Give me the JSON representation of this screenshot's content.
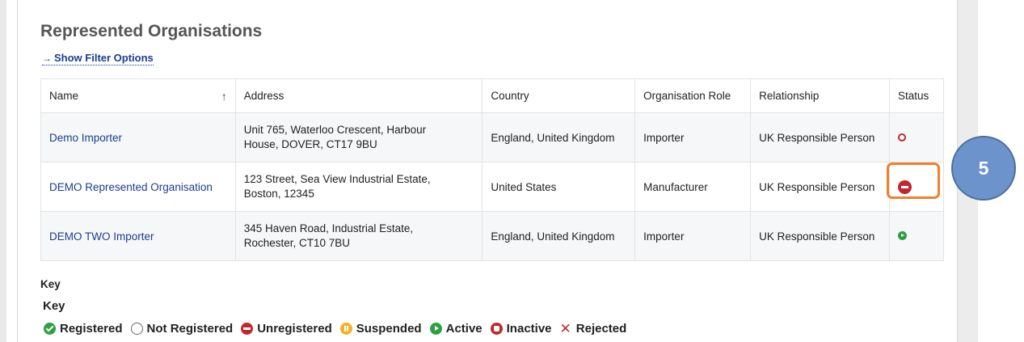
{
  "page": {
    "title": "Represented Organisations",
    "filter_link": "Show Filter Options",
    "filter_arrow": "→"
  },
  "table": {
    "headers": {
      "name": "Name",
      "sort_arrow": "↑",
      "address": "Address",
      "country": "Country",
      "role": "Organisation Role",
      "relationship": "Relationship",
      "status": "Status"
    },
    "rows": [
      {
        "name": "Demo Importer",
        "address_line1": "Unit 765, Waterloo Crescent, Harbour",
        "address_line2": "House, DOVER, CT17 9BU",
        "country": "England, United Kingdom",
        "role": "Importer",
        "relationship": "UK Responsible Person",
        "status_icon": "inactive-icon"
      },
      {
        "name": "DEMO Represented Organisation",
        "address_line1": "123 Street, Sea View Industrial Estate,",
        "address_line2": "Boston, 12345",
        "country": "United States",
        "role": "Manufacturer",
        "relationship": "UK Responsible Person",
        "status_icon": "unregistered-icon"
      },
      {
        "name": "DEMO TWO Importer",
        "address_line1": "345 Haven Road, Industrial Estate,",
        "address_line2": "Rochester, CT10 7BU",
        "country": "England, United Kingdom",
        "role": "Importer",
        "relationship": "UK Responsible Person",
        "status_icon": "active-icon"
      }
    ]
  },
  "annotation": {
    "step_number": "5",
    "highlight_color": "#f0802a",
    "badge_color": "#6c93cc"
  },
  "key": {
    "label": "Key",
    "heading": "Key",
    "items": [
      {
        "label": "Registered",
        "icon": "check-circle-icon",
        "color": "#2ea043"
      },
      {
        "label": "Not Registered",
        "icon": "empty-circle-icon",
        "color": "#666666"
      },
      {
        "label": "Unregistered",
        "icon": "no-entry-icon",
        "color": "#c0272d"
      },
      {
        "label": "Suspended",
        "icon": "pause-circle-icon",
        "color": "#f0b323"
      },
      {
        "label": "Active",
        "icon": "play-circle-icon",
        "color": "#2ea043"
      },
      {
        "label": "Inactive",
        "icon": "stop-circle-icon",
        "color": "#c0272d"
      },
      {
        "label": "Rejected",
        "icon": "cross-icon",
        "glyph": "✕",
        "color": "#c0272d"
      }
    ]
  },
  "colors": {
    "link": "#1a3d8f",
    "title": "#555555"
  }
}
